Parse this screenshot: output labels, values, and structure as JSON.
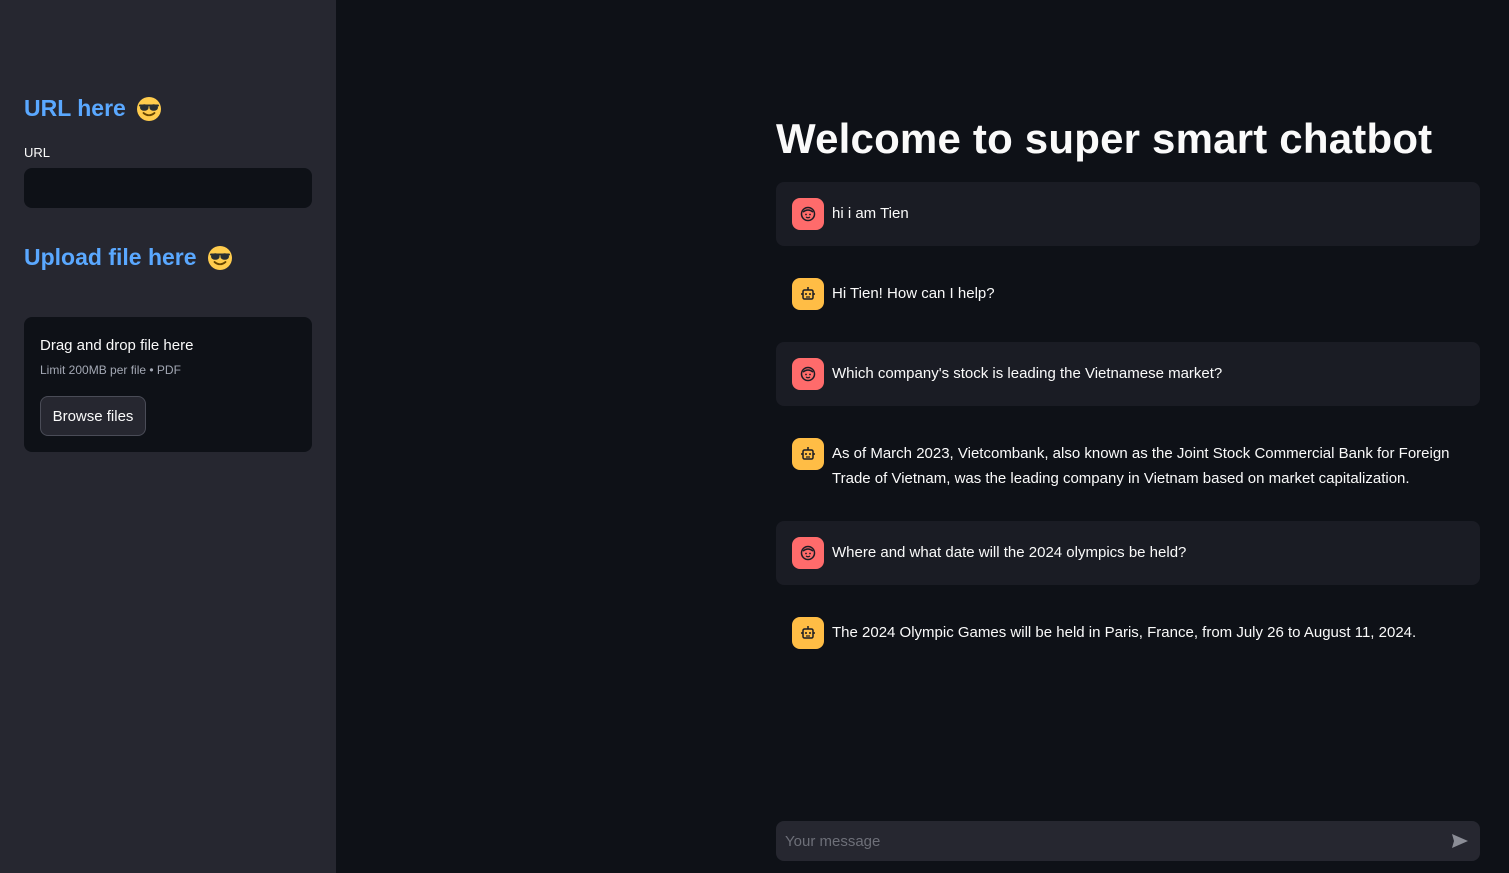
{
  "sidebar": {
    "url_heading": "URL here",
    "url_label": "URL",
    "url_value": "",
    "upload_heading": "Upload file here",
    "dropzone_title": "Drag and drop file here",
    "dropzone_limit": "Limit 200MB per file • PDF",
    "browse_label": "Browse files"
  },
  "main": {
    "title": "Welcome to super smart chatbot",
    "messages": [
      {
        "role": "user",
        "text": "hi i am Tien"
      },
      {
        "role": "assistant",
        "text": "Hi Tien! How can I help?"
      },
      {
        "role": "user",
        "text": "Which company's stock is leading the Vietnamese market?"
      },
      {
        "role": "assistant",
        "text": "As of March 2023, Vietcombank, also known as the Joint Stock Commercial Bank for Foreign Trade of Vietnam, was the leading company in Vietnam based on market capitalization."
      },
      {
        "role": "user",
        "text": "Where and what date will the 2024 olympics be held?"
      },
      {
        "role": "assistant",
        "text": "The 2024 Olympic Games will be held in Paris, France, from July 26 to August 11, 2024."
      }
    ],
    "chat_placeholder": "Your message"
  },
  "colors": {
    "accent_blue": "#5aa8ff",
    "user_avatar": "#ff6b6b",
    "bot_avatar": "#ffbd45",
    "sidebar_bg": "#262730",
    "main_bg": "#0e1117"
  },
  "icons": {
    "heading_emoji": "smiling-face-with-sunglasses-icon",
    "user_avatar": "user-face-icon",
    "bot_avatar": "robot-icon",
    "send": "send-icon"
  }
}
